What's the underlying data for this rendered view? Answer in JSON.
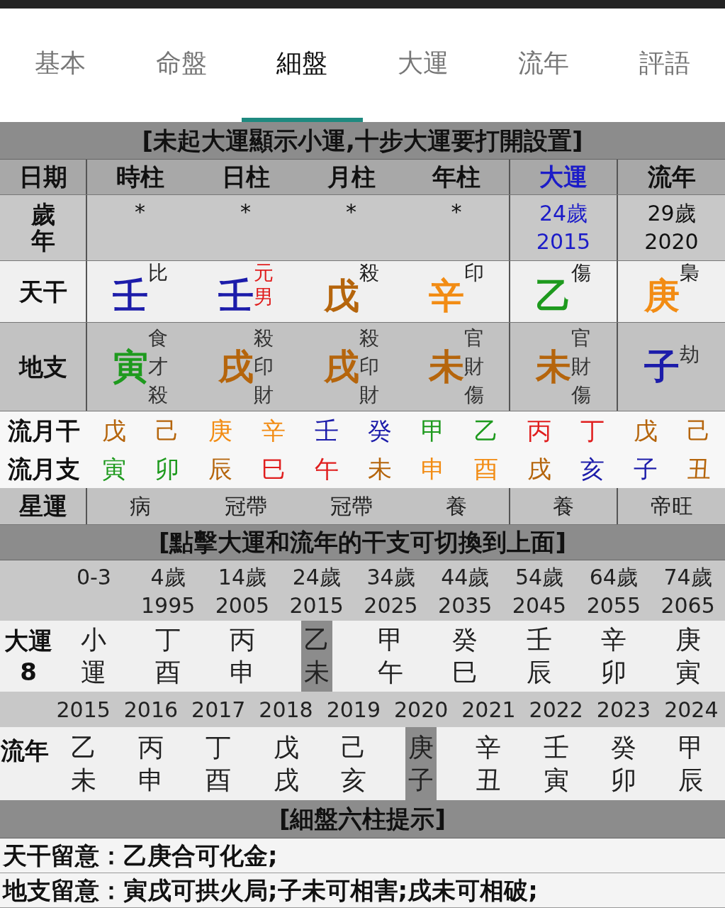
{
  "tabs": [
    {
      "label": "基本",
      "selected": false
    },
    {
      "label": "命盤",
      "selected": false
    },
    {
      "label": "細盤",
      "selected": true
    },
    {
      "label": "大運",
      "selected": false
    },
    {
      "label": "流年",
      "selected": false
    },
    {
      "label": "評語",
      "selected": false
    }
  ],
  "banner": "[未起大運顯示小運,十步大運要打開設置]",
  "chart": {
    "columns": [
      {
        "label": "日期",
        "color": "#111111"
      },
      {
        "label": "時柱",
        "color": "#111111"
      },
      {
        "label": "日柱",
        "color": "#111111"
      },
      {
        "label": "月柱",
        "color": "#111111"
      },
      {
        "label": "年柱",
        "color": "#111111"
      },
      {
        "label": "大運",
        "color": "#1c1cc8"
      },
      {
        "label": "流年",
        "color": "#111111"
      }
    ],
    "row_labels": {
      "age": "歲年",
      "stem": "天干",
      "branch": "地支",
      "star": "星運"
    },
    "pillars": [
      {
        "age": {
          "text": "*",
          "color": "#111111"
        },
        "stem": {
          "char": "壬",
          "color": "#1c1caa",
          "tags": [
            {
              "text": "比",
              "color": "#222222"
            }
          ]
        },
        "branch": {
          "char": "寅",
          "color": "#1e9a1e",
          "hidden": [
            "食",
            "才",
            "殺"
          ]
        },
        "star": "病"
      },
      {
        "age": {
          "text": "*",
          "color": "#111111"
        },
        "stem": {
          "char": "壬",
          "color": "#1c1caa",
          "tags": [
            {
              "text": "元",
              "color": "#e01e1e"
            },
            {
              "text": "男",
              "color": "#e01e1e"
            }
          ]
        },
        "branch": {
          "char": "戌",
          "color": "#b5650c",
          "hidden": [
            "殺",
            "印",
            "財"
          ]
        },
        "star": "冠帶"
      },
      {
        "age": {
          "text": "*",
          "color": "#111111"
        },
        "stem": {
          "char": "戊",
          "color": "#b5650c",
          "tags": [
            {
              "text": "殺",
              "color": "#222222"
            }
          ]
        },
        "branch": {
          "char": "戌",
          "color": "#b5650c",
          "hidden": [
            "殺",
            "印",
            "財"
          ]
        },
        "star": "冠帶"
      },
      {
        "age": {
          "text": "*",
          "color": "#111111"
        },
        "stem": {
          "char": "辛",
          "color": "#f28c14",
          "tags": [
            {
              "text": "印",
              "color": "#222222"
            }
          ]
        },
        "branch": {
          "char": "未",
          "color": "#b5650c",
          "hidden": [
            "官",
            "財",
            "傷"
          ]
        },
        "star": "養"
      },
      {
        "age": {
          "text": "24歲",
          "year": "2015",
          "color": "#1c1cc8"
        },
        "stem": {
          "char": "乙",
          "color": "#1e9a1e",
          "tags": [
            {
              "text": "傷",
              "color": "#222222"
            }
          ]
        },
        "branch": {
          "char": "未",
          "color": "#b5650c",
          "hidden": [
            "官",
            "財",
            "傷"
          ]
        },
        "star": "養"
      },
      {
        "age": {
          "text": "29歲",
          "year": "2020",
          "color": "#111111"
        },
        "stem": {
          "char": "庚",
          "color": "#f28c14",
          "tags": [
            {
              "text": "梟",
              "color": "#222222"
            }
          ]
        },
        "branch": {
          "char": "子",
          "color": "#1c1caa",
          "hidden": [
            "劫"
          ]
        },
        "star": "帝旺"
      }
    ]
  },
  "monthly": [
    {
      "label": "流月干",
      "items": [
        {
          "char": "戊",
          "color": "#b5650c"
        },
        {
          "char": "己",
          "color": "#b5650c"
        },
        {
          "char": "庚",
          "color": "#f28c14"
        },
        {
          "char": "辛",
          "color": "#f28c14"
        },
        {
          "char": "壬",
          "color": "#1c1caa"
        },
        {
          "char": "癸",
          "color": "#1c1caa"
        },
        {
          "char": "甲",
          "color": "#1e9a1e"
        },
        {
          "char": "乙",
          "color": "#1e9a1e"
        },
        {
          "char": "丙",
          "color": "#e01e1e"
        },
        {
          "char": "丁",
          "color": "#e01e1e"
        },
        {
          "char": "戊",
          "color": "#b5650c"
        },
        {
          "char": "己",
          "color": "#b5650c"
        }
      ]
    },
    {
      "label": "流月支",
      "items": [
        {
          "char": "寅",
          "color": "#1e9a1e"
        },
        {
          "char": "卯",
          "color": "#1e9a1e"
        },
        {
          "char": "辰",
          "color": "#b5650c"
        },
        {
          "char": "巳",
          "color": "#e01e1e"
        },
        {
          "char": "午",
          "color": "#e01e1e"
        },
        {
          "char": "未",
          "color": "#b5650c"
        },
        {
          "char": "申",
          "color": "#f28c14"
        },
        {
          "char": "酉",
          "color": "#f28c14"
        },
        {
          "char": "戌",
          "color": "#b5650c"
        },
        {
          "char": "亥",
          "color": "#1c1caa"
        },
        {
          "char": "子",
          "color": "#1c1caa"
        },
        {
          "char": "丑",
          "color": "#b5650c"
        }
      ]
    }
  ],
  "hint": "[點擊大運和流年的干支可切換到上面]",
  "luck": {
    "label": "大運",
    "number": "8",
    "ages": [
      {
        "age": "0-3"
      },
      {
        "age": "4歲",
        "year": "1995"
      },
      {
        "age": "14歲",
        "year": "2005"
      },
      {
        "age": "24歲",
        "year": "2015"
      },
      {
        "age": "34歲",
        "year": "2025"
      },
      {
        "age": "44歲",
        "year": "2035"
      },
      {
        "age": "54歲",
        "year": "2045"
      },
      {
        "age": "64歲",
        "year": "2055"
      },
      {
        "age": "74歲",
        "year": "2065"
      }
    ],
    "items": [
      {
        "top": "小",
        "bottom": "運",
        "selected": false
      },
      {
        "top": "丁",
        "bottom": "酉",
        "selected": false
      },
      {
        "top": "丙",
        "bottom": "申",
        "selected": false
      },
      {
        "top": "乙",
        "bottom": "未",
        "selected": true
      },
      {
        "top": "甲",
        "bottom": "午",
        "selected": false
      },
      {
        "top": "癸",
        "bottom": "巳",
        "selected": false
      },
      {
        "top": "壬",
        "bottom": "辰",
        "selected": false
      },
      {
        "top": "辛",
        "bottom": "卯",
        "selected": false
      },
      {
        "top": "庚",
        "bottom": "寅",
        "selected": false
      }
    ]
  },
  "annual": {
    "label": "流年",
    "years": [
      "2015",
      "2016",
      "2017",
      "2018",
      "2019",
      "2020",
      "2021",
      "2022",
      "2023",
      "2024"
    ],
    "items": [
      {
        "top": "乙",
        "bottom": "未",
        "selected": false
      },
      {
        "top": "丙",
        "bottom": "申",
        "selected": false
      },
      {
        "top": "丁",
        "bottom": "酉",
        "selected": false
      },
      {
        "top": "戊",
        "bottom": "戌",
        "selected": false
      },
      {
        "top": "己",
        "bottom": "亥",
        "selected": false
      },
      {
        "top": "庚",
        "bottom": "子",
        "selected": true
      },
      {
        "top": "辛",
        "bottom": "丑",
        "selected": false
      },
      {
        "top": "壬",
        "bottom": "寅",
        "selected": false
      },
      {
        "top": "癸",
        "bottom": "卯",
        "selected": false
      },
      {
        "top": "甲",
        "bottom": "辰",
        "selected": false
      }
    ]
  },
  "notes_title": "[細盤六柱提示]",
  "notes": [
    {
      "label": "天干留意：",
      "text": "乙庚合可化金;"
    },
    {
      "label": "地支留意：",
      "text": "寅戌可拱火局;子未可相害;戌未可相破;"
    }
  ]
}
